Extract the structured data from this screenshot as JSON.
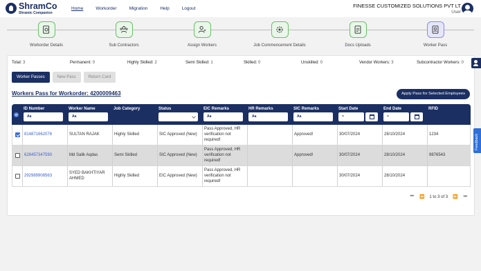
{
  "header": {
    "logo_name": "ShramCo",
    "logo_tagline": "Shramic Companion",
    "nav": [
      "Home",
      "Workorder",
      "Migration",
      "Help",
      "Logout"
    ],
    "company": "FINESSE CUSTOMIZED SOLUTIONS PVT LT",
    "user": "User"
  },
  "steps": [
    {
      "label": "Workorder Details",
      "icon": "document-gear-icon"
    },
    {
      "label": "Sub Contractors",
      "icon": "people-icon"
    },
    {
      "label": "Assign Workers",
      "icon": "assign-user-icon"
    },
    {
      "label": "Job Commencement Details",
      "icon": "gear-check-icon"
    },
    {
      "label": "Docs Uploads",
      "icon": "document-icon"
    },
    {
      "label": "Worker Pass",
      "icon": "pass-icon"
    }
  ],
  "stats": {
    "total_label": "Total:",
    "total": "3",
    "permanent_label": "Permanent:",
    "permanent": "0",
    "highly_skilled_label": "Highly Skilled:",
    "highly_skilled": "2",
    "semi_skilled_label": "Semi Skilled:",
    "semi_skilled": "1",
    "skilled_label": "Skilled:",
    "skilled": "0",
    "unskilled_label": "Unskilled:",
    "unskilled": "0",
    "vendor_label": "Vendor Workers:",
    "vendor": "3",
    "subcontractor_label": "Subcontractor Workers:",
    "subcontractor": "0"
  },
  "tabs": [
    "Worker Passes",
    "New Pass",
    "Return Card"
  ],
  "title": "Workers Pass for Workorder: 4200009463",
  "apply_button": "Apply Pass for Selected Employees",
  "columns": [
    "ID Number",
    "Worker Name",
    "Job Category",
    "Status",
    "EIC Remarks",
    "HR Remarks",
    "SIC Remarks",
    "Start Date",
    "End Date",
    "RFID"
  ],
  "filter_icon_text": "Aa",
  "date_filter_text": "=",
  "rows": [
    {
      "checked": true,
      "id": "814871662076",
      "name": "SULTAN RAJAK",
      "category": "Highly Skilled",
      "status": "SIC Approved (New)",
      "eic": "Pass Approved, HR verification not required!",
      "hr": "",
      "sic": "Approved!",
      "start": "30/07/2024",
      "end": "28/10/2024",
      "rfid": "1234"
    },
    {
      "checked": false,
      "id": "628457347590",
      "name": "Md Salik Aqdas",
      "category": "Semi Skilled",
      "status": "SIC Approved (New)",
      "eic": "Pass Approved, HR verification not required!",
      "hr": "",
      "sic": "Approved!",
      "start": "30/07/2024",
      "end": "28/10/2024",
      "rfid": "9876543"
    },
    {
      "checked": false,
      "id": "292989908563",
      "name": "SYED BAKHTIYAR AHMED",
      "category": "Highly Skilled",
      "status": "EIC Approved (New)",
      "eic": "Pass Approved, HR verification not required!",
      "hr": "",
      "sic": "",
      "start": "30/07/2024",
      "end": "28/10/2024",
      "rfid": ""
    }
  ],
  "pager": {
    "first": "⏮",
    "prev": "⏪",
    "text": "1 to 3 of 3",
    "next": "⏩",
    "last": "⏭"
  },
  "feedback": "Feedback",
  "colors": {
    "primary": "#1b2f63",
    "step_border": "#6bbf6b",
    "active_step": "#8a8ae0",
    "link": "#3a5fcd"
  }
}
